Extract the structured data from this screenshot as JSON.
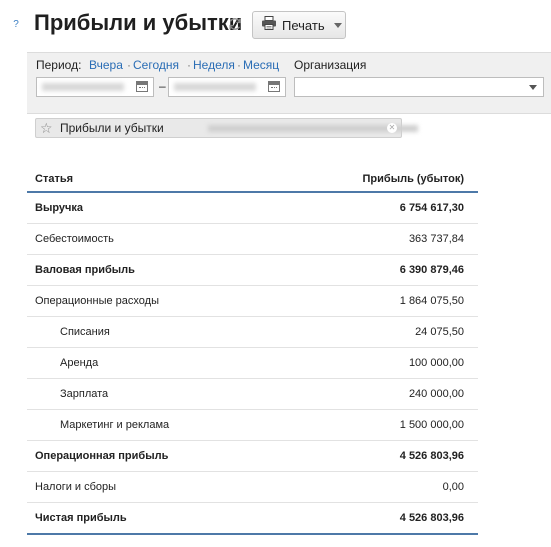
{
  "header": {
    "help_glyph": "?",
    "title": "Прибыли и убытки",
    "print_label": "Печать"
  },
  "filters": {
    "period_label": "Период:",
    "period_links": [
      "Вчера",
      "Сегодня",
      "Неделя",
      "Месяц"
    ],
    "organization_label": "Организация",
    "date_separator": "–",
    "organization_value": ""
  },
  "chip": {
    "label": "Прибыли и убытки"
  },
  "table": {
    "columns": [
      "Статья",
      "Прибыль (убыток)"
    ],
    "rows": [
      {
        "name": "Выручка",
        "value": "6 754 617,30",
        "bold": true,
        "indent": false
      },
      {
        "name": "Себестоимость",
        "value": "363 737,84",
        "bold": false,
        "indent": false
      },
      {
        "name": "Валовая прибыль",
        "value": "6 390 879,46",
        "bold": true,
        "indent": false
      },
      {
        "name": "Операционные расходы",
        "value": "1 864 075,50",
        "bold": false,
        "indent": false
      },
      {
        "name": "Списания",
        "value": "24 075,50",
        "bold": false,
        "indent": true
      },
      {
        "name": "Аренда",
        "value": "100 000,00",
        "bold": false,
        "indent": true
      },
      {
        "name": "Зарплата",
        "value": "240 000,00",
        "bold": false,
        "indent": true
      },
      {
        "name": "Маркетинг и реклама",
        "value": "1 500 000,00",
        "bold": false,
        "indent": true
      },
      {
        "name": "Операционная прибыль",
        "value": "4 526 803,96",
        "bold": true,
        "indent": false
      },
      {
        "name": "Налоги и сборы",
        "value": "0,00",
        "bold": false,
        "indent": false
      },
      {
        "name": "Чистая прибыль",
        "value": "4 526 803,96",
        "bold": true,
        "indent": false
      }
    ]
  },
  "colors": {
    "link": "#2a6db5",
    "table_rule": "#4d79a8",
    "help": "#3b7fc4"
  }
}
